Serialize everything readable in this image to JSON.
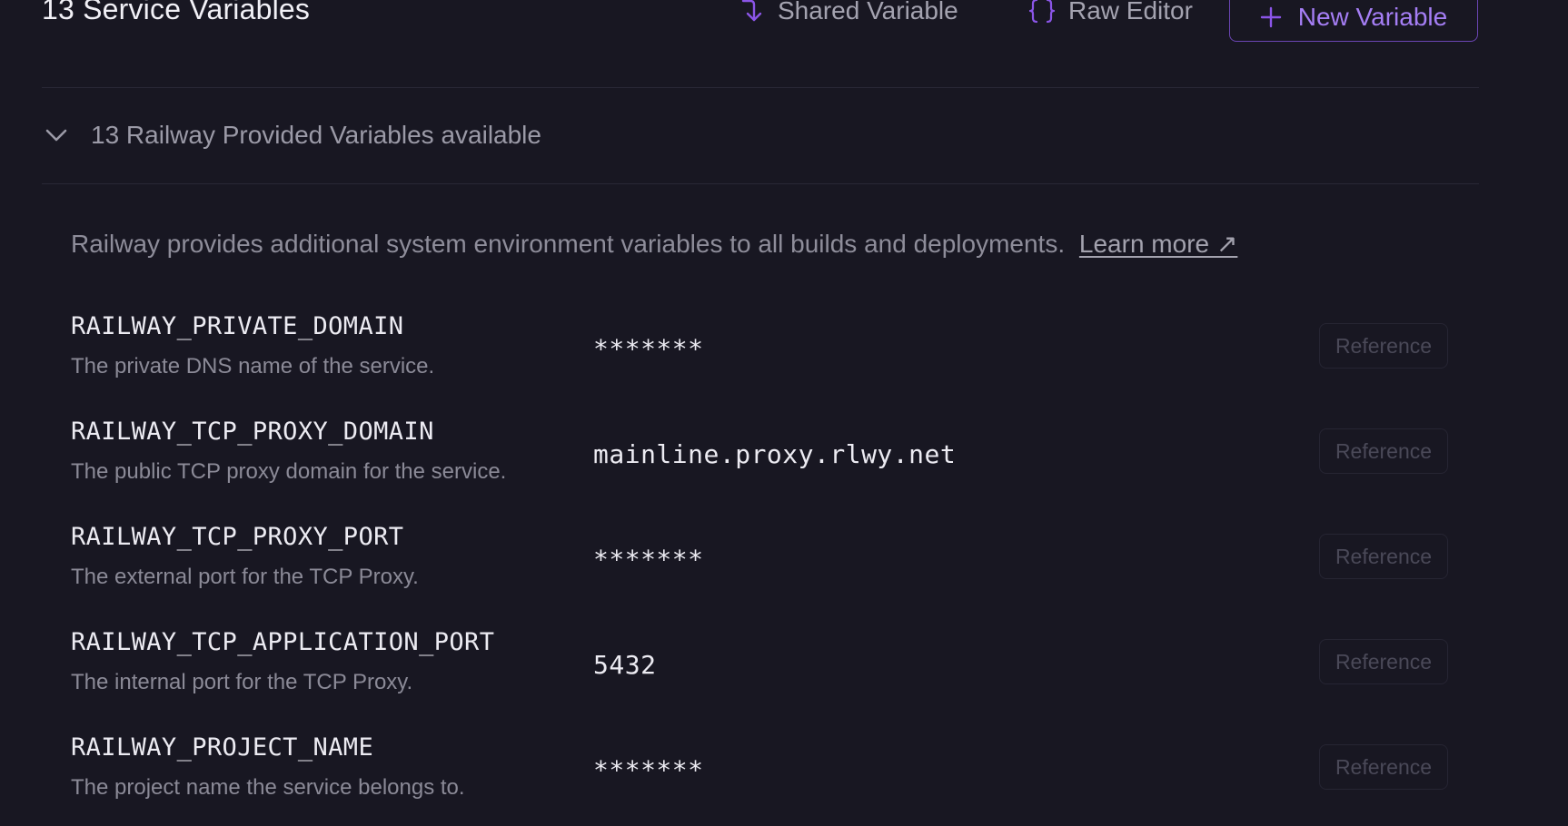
{
  "header": {
    "title": "13 Service Variables",
    "shared_label": "Shared Variable",
    "shared_icon": "corner-down-right-icon",
    "raw_label": "Raw Editor",
    "raw_icon": "braces-icon",
    "new_label": "New Variable",
    "new_icon": "plus-icon"
  },
  "provided": {
    "toggle_label": "13 Railway Provided Variables available",
    "toggle_icon": "chevron-down-icon",
    "description": "Railway provides additional system environment variables to all builds and deployments.",
    "learn_more": "Learn more ↗"
  },
  "variables": [
    {
      "name": "RAILWAY_PRIVATE_DOMAIN",
      "description": "The private DNS name of the service.",
      "value": "*******",
      "action": "Reference"
    },
    {
      "name": "RAILWAY_TCP_PROXY_DOMAIN",
      "description": "The public TCP proxy domain for the service.",
      "value": "mainline.proxy.rlwy.net",
      "action": "Reference"
    },
    {
      "name": "RAILWAY_TCP_PROXY_PORT",
      "description": "The external port for the TCP Proxy.",
      "value": "*******",
      "action": "Reference"
    },
    {
      "name": "RAILWAY_TCP_APPLICATION_PORT",
      "description": "The internal port for the TCP Proxy.",
      "value": "5432",
      "action": "Reference"
    },
    {
      "name": "RAILWAY_PROJECT_NAME",
      "description": "The project name the service belongs to.",
      "value": "*******",
      "action": "Reference"
    }
  ],
  "colors": {
    "background": "#181722",
    "accent": "#8b55e8",
    "text": "#ecebf2",
    "muted": "#8b8a97"
  }
}
